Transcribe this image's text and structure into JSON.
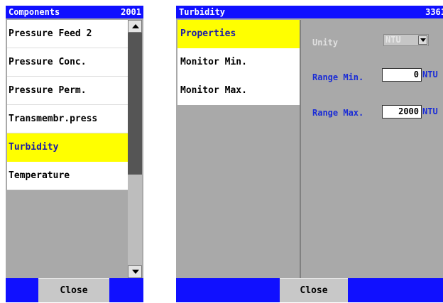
{
  "components_panel": {
    "title": "Components",
    "number": "2001",
    "items": [
      {
        "label": "Pressure Feed 2"
      },
      {
        "label": "Pressure Conc."
      },
      {
        "label": "Pressure Perm."
      },
      {
        "label": "Transmembr.press"
      },
      {
        "label": "Turbidity"
      },
      {
        "label": "Temperature"
      }
    ],
    "selected_index": 4,
    "close_label": "Close"
  },
  "detail_panel": {
    "title": "Turbidity",
    "number": "3361",
    "nav": [
      {
        "label": "Properties"
      },
      {
        "label": "Monitor Min."
      },
      {
        "label": "Monitor Max."
      }
    ],
    "selected_index": 0,
    "unity_label": "Unity",
    "unity_value": "NTU",
    "range_min_label": "Range Min.",
    "range_min_value": "0",
    "range_min_unit": "NTU",
    "range_max_label": "Range Max.",
    "range_max_value": "2000",
    "range_max_unit": "NTU",
    "close_label": "Close"
  },
  "colors": {
    "titlebar": "#1010ff",
    "selection": "#ffff00",
    "panel_bg": "#a9a9a9"
  },
  "icons": [
    "arrow-up-icon",
    "arrow-down-icon",
    "dropdown-arrow-icon"
  ]
}
